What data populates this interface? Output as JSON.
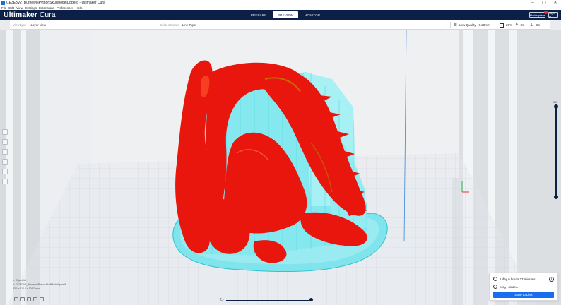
{
  "window": {
    "title": "CE3E3V2_BurnewolPythonSkullModelUpper8 - Ultimaker Cura",
    "controls": [
      "–",
      "▢",
      "✕"
    ]
  },
  "menu": [
    "File",
    "Edit",
    "View",
    "Settings",
    "Extensions",
    "Preferences",
    "Help"
  ],
  "header": {
    "logo_bold": "Ultimaker",
    "logo_light": " Cura",
    "stages": [
      "PREPARE",
      "PREVIEW",
      "MONITOR"
    ],
    "active_stage": "PREVIEW",
    "marketplace": "Marketplace",
    "signin": "Sign in"
  },
  "toolbar": {
    "view_type_label": "View type",
    "view_type_value": "Layer view",
    "color_scheme_label": "Color scheme",
    "color_scheme_value": "Line Type",
    "quality": "Low Quality - 0.28mm",
    "infill": "20%",
    "support": "On",
    "adhesion": "On"
  },
  "layer_slider": {
    "top_layer": "399",
    "fraction": 1.0
  },
  "object_list": {
    "label": "Object list",
    "file": "CE3E3V2_BurnewolPythonSkullModelUpper8",
    "dims": "93.1 x 110.3 x 108.3 mm"
  },
  "simulation": {
    "progress": 1.0
  },
  "print": {
    "time": "1 day 6 hours 27 minutes",
    "material": "265g · 83.87m",
    "save_label": "Save to Disk"
  },
  "colors": {
    "header_bg": "#0c1f46",
    "model_red": "#e8160c",
    "support_cyan": "#7fe4ec",
    "button_blue": "#196ef0"
  }
}
